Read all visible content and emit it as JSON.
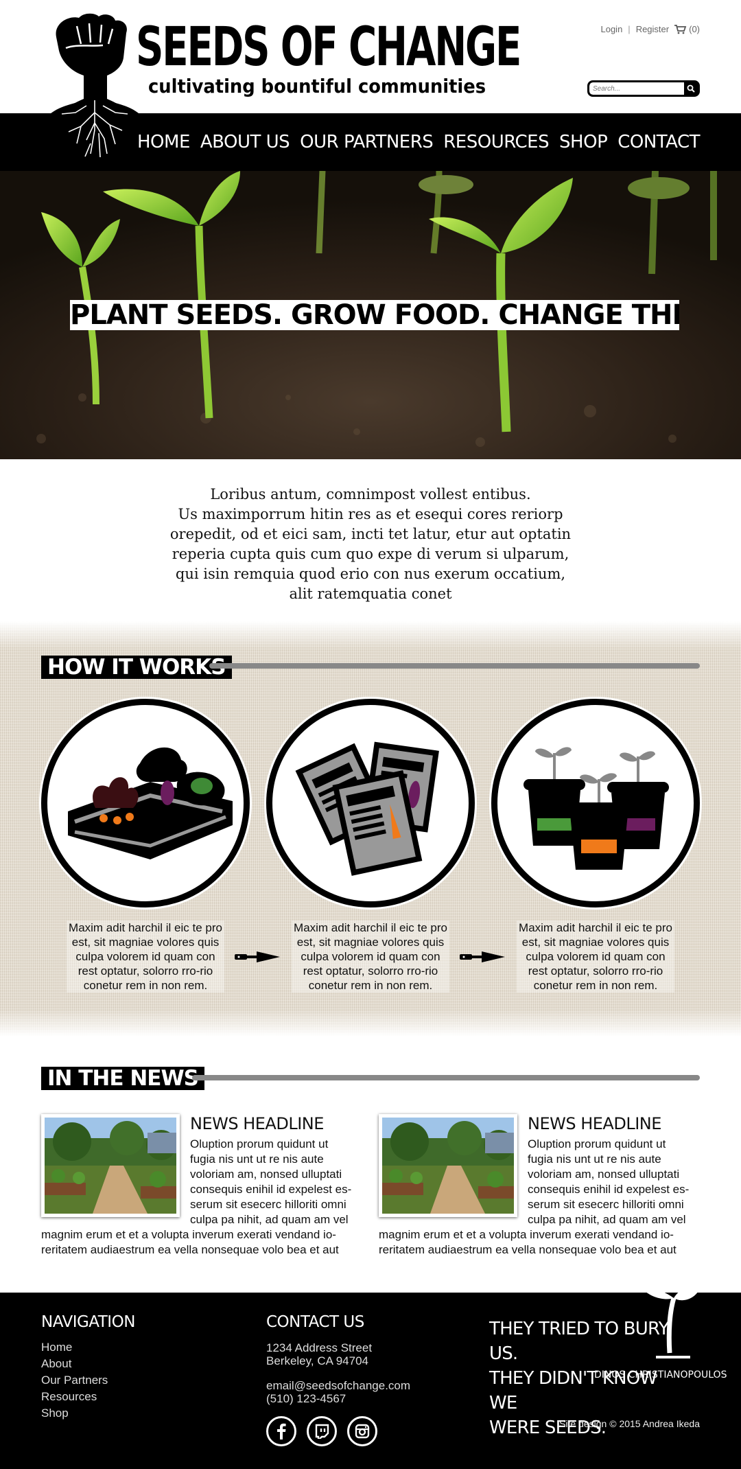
{
  "brand": {
    "title": "SEEDS OF CHANGE",
    "tagline": "cultivating bountiful communities"
  },
  "top_links": {
    "login": "Login",
    "separator": "|",
    "register": "Register",
    "cart_count": "(0)"
  },
  "search": {
    "placeholder": "Search..."
  },
  "nav": {
    "items": [
      "HOME",
      "ABOUT US",
      "OUR PARTNERS",
      "RESOURCES",
      "SHOP",
      "CONTACT"
    ]
  },
  "hero": {
    "slogan": "PLANT SEEDS. GROW FOOD. CHANGE THE WORLD."
  },
  "intro": {
    "lines": [
      "Loribus antum, comnimpost vollest entibus.",
      "Us maximporrum hitin res as et esequi cores reriorp",
      "orepedit, od et eici sam, incti tet latur, etur aut optatin",
      "reperia cupta quis cum quo expe di verum si ulparum,",
      "qui isin remquia quod erio con nus exerum occatium,",
      "alit ratemquatia conet"
    ]
  },
  "how_it_works": {
    "heading": "HOW IT WORKS",
    "steps": [
      {
        "icon": "garden-bed-icon",
        "text": "Maxim adit harchil il eic te pro est, sit magniae volores quis culpa volorem id quam con rest optatur, solorro rro-rio conetur rem in non rem."
      },
      {
        "icon": "seed-packets-icon",
        "text": "Maxim adit harchil il eic te pro est, sit magniae volores quis culpa volorem id quam con rest optatur, solorro rro-rio conetur rem in non rem."
      },
      {
        "icon": "seedling-pots-icon",
        "text": "Maxim adit harchil il eic te pro est, sit magniae volores quis culpa volorem id quam con rest optatur, solorro rro-rio conetur rem in non rem."
      }
    ]
  },
  "news": {
    "heading": "IN THE NEWS",
    "items": [
      {
        "headline": "NEWS HEADLINE",
        "lines_beside": [
          "Oluption prorum quidunt ut",
          "fugia nis unt ut re nis aute",
          "voloriam am, nonsed ulluptati",
          "consequis enihil id expelest es-",
          "serum sit esecerc hilloriti omni",
          "culpa pa nihit, ad quam am vel"
        ],
        "lines_full": [
          "magnim erum et et a volupta inverum exerati vendand io-",
          "reritatem audiaestrum ea vella nonsequae volo bea et aut"
        ]
      },
      {
        "headline": "NEWS HEADLINE",
        "lines_beside": [
          "Oluption prorum quidunt ut",
          "fugia nis unt ut re nis aute",
          "voloriam am, nonsed ulluptati",
          "consequis enihil id expelest es-",
          "serum sit esecerc hilloriti omni",
          "culpa pa nihit, ad quam am vel"
        ],
        "lines_full": [
          "magnim erum et et a volupta inverum exerati vendand io-",
          "reritatem audiaestrum ea vella nonsequae volo bea et aut"
        ]
      }
    ]
  },
  "footer": {
    "nav_heading": "NAVIGATION",
    "nav_items": [
      "Home",
      "About",
      "Our Partners",
      "Resources",
      "Shop"
    ],
    "contact_heading": "CONTACT US",
    "address_1": "1234 Address Street",
    "address_2": "Berkeley, CA 94704",
    "email": "email@seedsofchange.com",
    "phone": "(510) 123-4567",
    "social_icons": [
      "facebook-icon",
      "twitch-icon",
      "instagram-icon"
    ],
    "quote_lines": [
      "THEY TRIED TO BURY US.",
      "THEY DIDN'T KNOW WE",
      "WERE SEEDS."
    ],
    "quote_author": "DINOS CHRISTIANOPOULOS",
    "credit": "Site design © 2015 Andrea Ikeda"
  },
  "colors": {
    "black": "#000000",
    "rule_gray": "#888888",
    "linen": "#e4ddd0",
    "accent_orange": "#f07a1a",
    "accent_purple": "#6b1d5e",
    "accent_green": "#4a9a3a"
  }
}
